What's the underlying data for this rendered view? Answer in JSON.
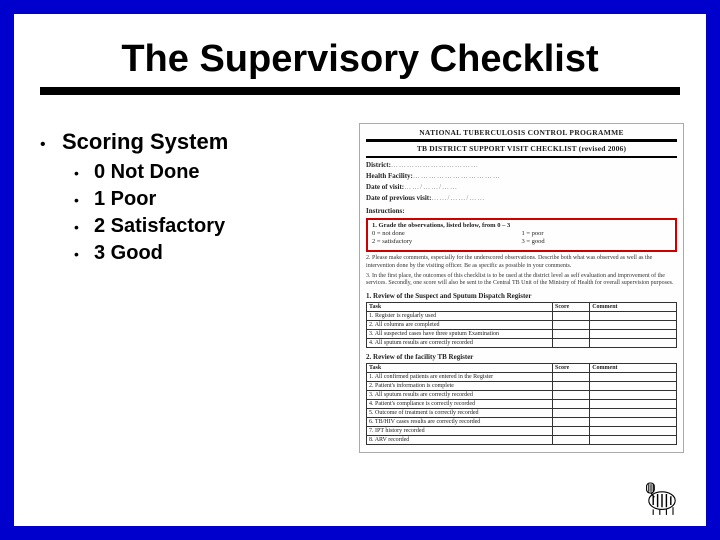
{
  "title": "The Supervisory Checklist",
  "main_bullet": "Scoring System",
  "scores": [
    "0 Not Done",
    "1 Poor",
    "2 Satisfactory",
    "3 Good"
  ],
  "doc": {
    "header1": "NATIONAL TUBERCULOSIS CONTROL PROGRAMME",
    "header2": "TB DISTRICT SUPPORT VISIT CHECKLIST (revised 2006)",
    "field_district": "District:",
    "field_facility": "Health Facility:",
    "field_date": "Date of visit:",
    "field_prev": "Date of previous visit:",
    "instr_label": "Instructions:",
    "grade_title": "1. Grade the observations, listed below, from 0 – 3",
    "grade_0": "0 = not done",
    "grade_1": "1 = poor",
    "grade_2": "2 = satisfactory",
    "grade_3": "3 = good",
    "note2": "2. Please make comments, especially for the underscored observations. Describe both what was observed as well as the intervention done by the visiting officer. Be as specific as possible in your comments.",
    "note3": "3. In the first place, the outcomes of this checklist is to be used at the district level as self evaluation and improvement of the services. Secondly, one score will also be sent to the Central TB Unit of the Ministry of Health for overall supervision purposes.",
    "sec1": "1. Review of the Suspect and Sputum Dispatch Register",
    "t1": {
      "h_task": "Task",
      "h_score": "Score",
      "h_comment": "Comment",
      "rows": [
        "1. Register is regularly used",
        "2. All columns are completed",
        "3. All suspected cases have three sputum Examination",
        "4. All sputum results are correctly recorded"
      ]
    },
    "sec2": "2. Review of the facility TB Register",
    "t2": {
      "h_task": "Task",
      "h_score": "Score",
      "h_comment": "Comment",
      "rows": [
        "1. All confirmed patients are entered in the Register",
        "2. Patient's information is complete",
        "3. All sputum results are correctly recorded",
        "4. Patient's compliance is correctly recorded",
        "5. Outcome of treatment is correctly recorded",
        "6. TB/HIV cases results are correctly recorded",
        "7. IPT history recorded",
        "8. ARV recorded"
      ]
    }
  }
}
